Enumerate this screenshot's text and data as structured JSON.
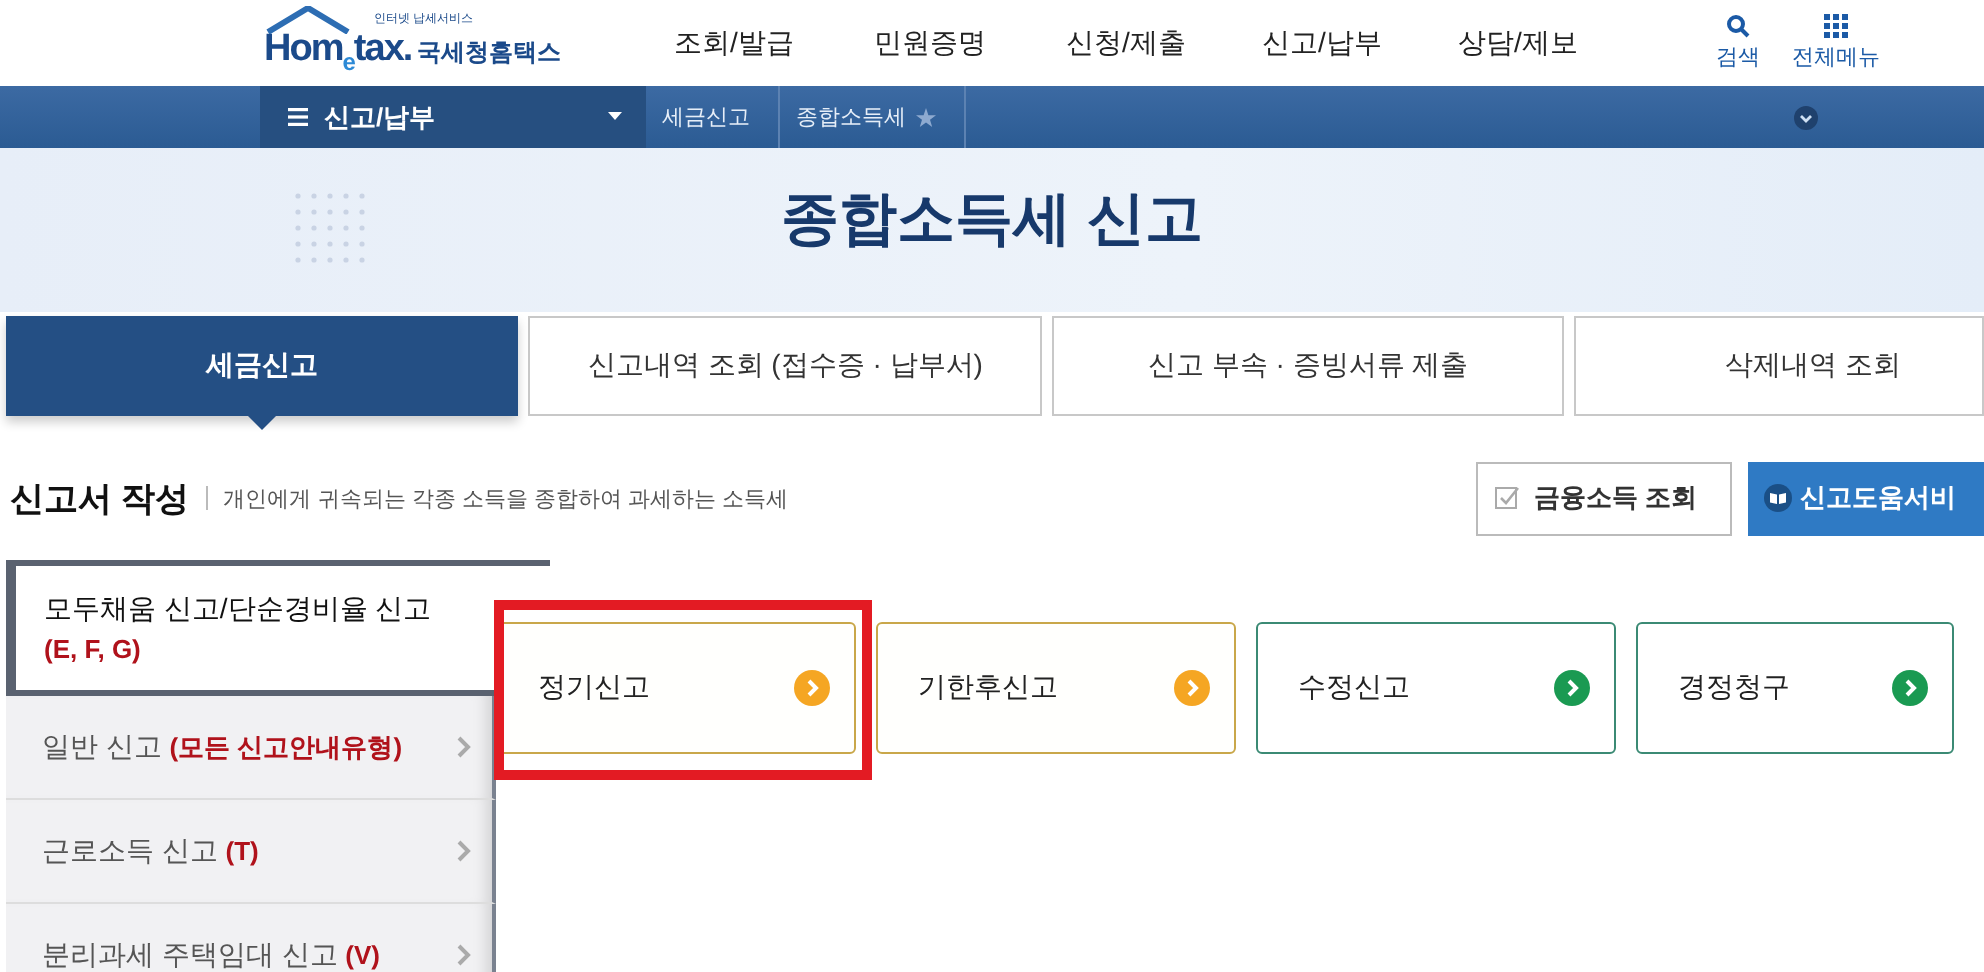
{
  "header": {
    "logo": {
      "tagline": "인터넷 납세서비스",
      "wordmark": "Hom$_{e}$tax.",
      "name": "국세청홈택스"
    },
    "nav": [
      "조회/발급",
      "민원증명",
      "신청/제출",
      "신고/납부",
      "상담/제보"
    ],
    "utilities": [
      {
        "kind": "search",
        "label": "검색"
      },
      {
        "kind": "menu",
        "label": "전체메뉴"
      }
    ]
  },
  "menu_bar": {
    "current": "신고/납부",
    "breadcrumbs": [
      {
        "label": "세금신고",
        "favorite": false
      },
      {
        "label": "종합소득세",
        "favorite": true
      }
    ]
  },
  "page_title": "종합소득세 신고",
  "tabs": [
    {
      "label": "세금신고",
      "selected": true
    },
    {
      "label": "신고내역 조회 (접수증 · 납부서)",
      "selected": false
    },
    {
      "label": "신고 부속 · 증빙서류 제출",
      "selected": false
    },
    {
      "label": "삭제내역 조회",
      "selected": false
    }
  ],
  "section": {
    "title": "신고서 작성",
    "description": "개인에게 귀속되는 각종 소득을 종합하여 과세하는 소득세"
  },
  "buttons": [
    {
      "kind": "check",
      "label": "금융소득 조회"
    },
    {
      "kind": "book",
      "label": "신고도움서비"
    }
  ],
  "side_menu": [
    {
      "label": "모두채움 신고/단순경비율 신고",
      "code": "(E, F, G)",
      "selected": true
    },
    {
      "label": "일반 신고",
      "code": "(모든 신고안내유형)",
      "selected": false
    },
    {
      "label": "근로소득 신고",
      "code": "(T)",
      "selected": false
    },
    {
      "label": "분리과세 주택임대 신고",
      "code": "(V)",
      "selected": false
    }
  ],
  "cards": [
    {
      "label": "정기신고",
      "color": "#f5a623",
      "highlighted": true
    },
    {
      "label": "기한후신고",
      "color": "#f5a623",
      "highlighted": false
    },
    {
      "label": "수정신고",
      "color": "#1a9a52",
      "highlighted": false
    },
    {
      "label": "경정청구",
      "color": "#1a9a52",
      "highlighted": false
    }
  ]
}
